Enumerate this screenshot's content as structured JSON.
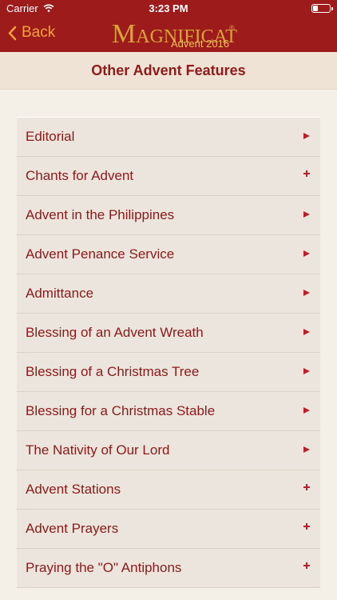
{
  "status": {
    "carrier": "Carrier",
    "time": "3:23 PM"
  },
  "nav": {
    "back_label": "Back",
    "brand_first": "M",
    "brand_rest": "AGNIFICAT",
    "brand_subtitle": "Advent 2016"
  },
  "section": {
    "title": "Other Advent Features"
  },
  "colors": {
    "brand": "#9e1b1b",
    "accent": "#f2a23a",
    "text": "#8a1a1a"
  },
  "items": [
    {
      "label": "Editorial",
      "indicator": "arrow"
    },
    {
      "label": "Chants for Advent",
      "indicator": "plus"
    },
    {
      "label": "Advent in the Philippines",
      "indicator": "arrow"
    },
    {
      "label": "Advent Penance Service",
      "indicator": "arrow"
    },
    {
      "label": "Admittance",
      "indicator": "arrow"
    },
    {
      "label": "Blessing of an Advent Wreath",
      "indicator": "arrow"
    },
    {
      "label": "Blessing of a Christmas Tree",
      "indicator": "arrow"
    },
    {
      "label": "Blessing for a Christmas Stable",
      "indicator": "arrow"
    },
    {
      "label": "The Nativity of Our Lord",
      "indicator": "arrow"
    },
    {
      "label": "Advent Stations",
      "indicator": "plus"
    },
    {
      "label": "Advent Prayers",
      "indicator": "plus"
    },
    {
      "label": "Praying the \"O\" Antiphons",
      "indicator": "plus"
    }
  ]
}
